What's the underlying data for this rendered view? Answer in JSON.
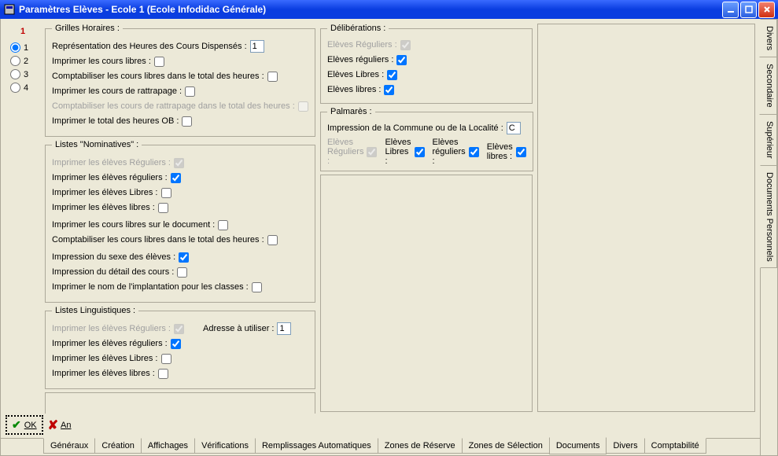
{
  "window": {
    "title": "Paramètres Elèves - Ecole 1 (Ecole Infodidac Générale)"
  },
  "left": {
    "heading": "1",
    "options": [
      "1",
      "2",
      "3",
      "4"
    ],
    "selected": "1"
  },
  "grilles": {
    "legend": "Grilles Horaires :",
    "repr_label": "Représentation des Heures des Cours Dispensés :",
    "repr_value": "1",
    "imp_cours_libres": "Imprimer les cours libres :",
    "compta_libres_total": "Comptabiliser les cours libres dans le total des heures :",
    "imp_rattrapage": "Imprimer les cours de rattrapage :",
    "compta_rattrapage_total": "Comptabiliser les cours de rattrapage dans le total des heures :",
    "imp_total_ob": "Imprimer le total des heures OB :"
  },
  "nominatives": {
    "legend": "Listes \"Nominatives\" :",
    "imp_reg_d": "Imprimer les élèves Réguliers :",
    "imp_reg": "Imprimer les élèves réguliers :",
    "imp_libres_cap": "Imprimer les élèves Libres :",
    "imp_libres": "Imprimer les élèves libres :",
    "imp_cours_libres_doc": "Imprimer les cours libres sur le document :",
    "compta_libres_total": "Comptabiliser les cours libres dans le total des heures :",
    "impr_sexe": "Impression du sexe des élèves :",
    "impr_detail": "Impression du détail des cours :",
    "impr_implant": "Imprimer le nom de l'implantation pour les classes :"
  },
  "ling": {
    "legend": "Listes Linguistiques :",
    "imp_reg_d": "Imprimer les élèves Réguliers :",
    "addr_label": "Adresse à utiliser :",
    "addr_value": "1",
    "imp_reg": "Imprimer les élèves réguliers :",
    "imp_libres_cap": "Imprimer les élèves Libres :",
    "imp_libres": "Imprimer les élèves libres :"
  },
  "delib": {
    "legend": "Délibérations :",
    "reg_d": "Elèves Réguliers :",
    "reg": "Elèves réguliers :",
    "libres_cap": "Elèves Libres :",
    "libres": "Elèves libres :"
  },
  "palmares": {
    "legend": "Palmarès :",
    "impr_commune": "Impression de la Commune ou de la Localité :",
    "impr_commune_val": "C",
    "reg_d": "Elèves Réguliers :",
    "reg": "Elèves réguliers :",
    "libres_cap": "Elèves Libres :",
    "libres": "Elèves libres :"
  },
  "buttons": {
    "ok": "OK",
    "an": "An"
  },
  "tabs_bottom": [
    "Généraux",
    "Création",
    "Affichages",
    "Vérifications",
    "Remplissages Automatiques",
    "Zones de Réserve",
    "Zones de Sélection",
    "Documents",
    "Divers",
    "Comptabilité"
  ],
  "tabs_bottom_active": "Documents",
  "tabs_side": [
    "Divers",
    "Secondaire",
    "Supérieur",
    "Documents Personnels"
  ],
  "tabs_side_active": "Secondaire"
}
